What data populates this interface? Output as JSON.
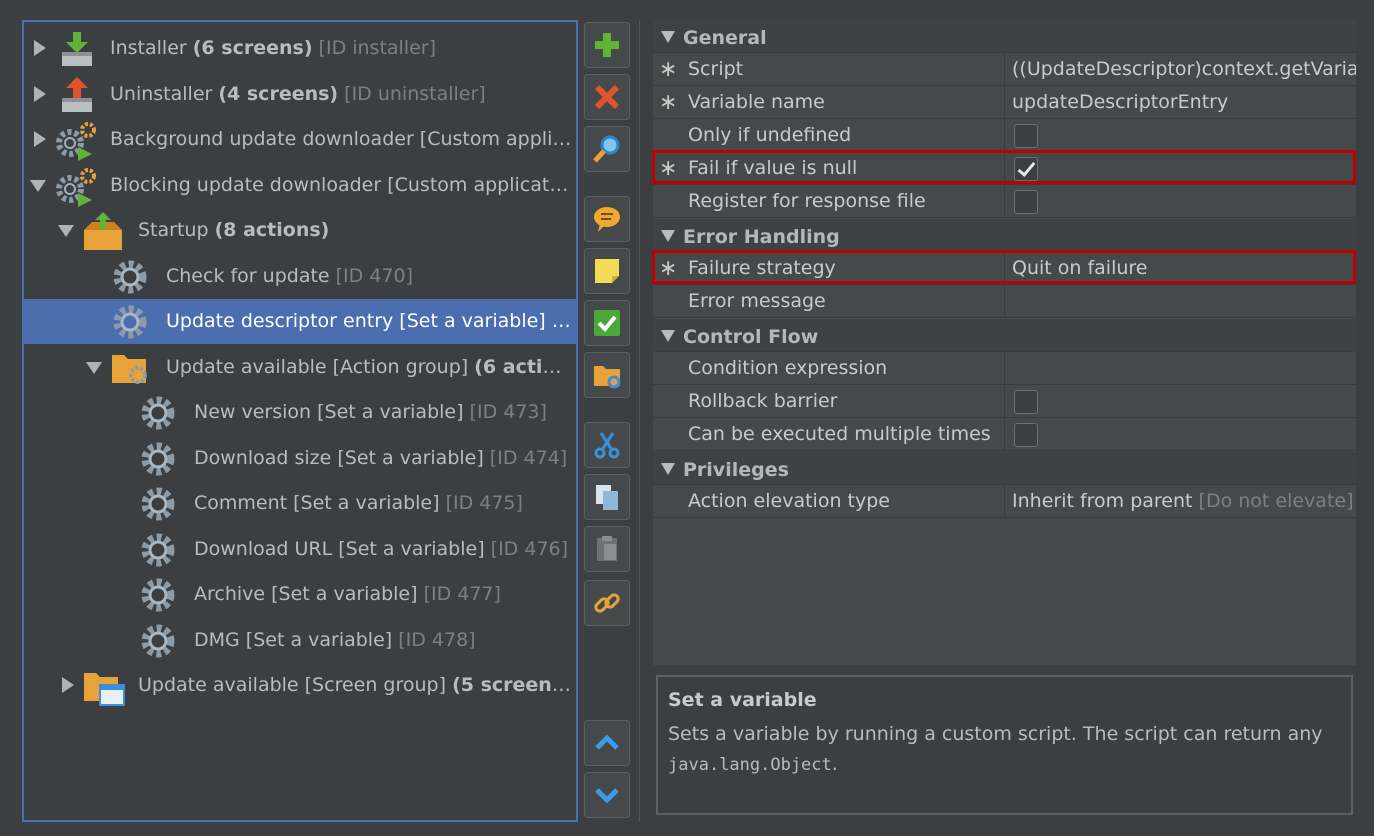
{
  "tree": {
    "items": [
      {
        "label": "Installer ",
        "bold": "(6 screens)",
        "gray": " [ID installer]",
        "icon": "installer-icon",
        "arrow": "collapsed"
      },
      {
        "label": "Uninstaller ",
        "bold": "(4 screens)",
        "gray": " [ID uninstaller]",
        "icon": "uninstaller-icon",
        "arrow": "collapsed"
      },
      {
        "label": "Background update downloader [Custom applic...",
        "bold": "",
        "gray": "",
        "icon": "gears-play-icon",
        "arrow": "collapsed"
      },
      {
        "label": "Blocking update downloader [Custom applicatio...",
        "bold": "",
        "gray": "",
        "icon": "gears-play-icon",
        "arrow": "expanded"
      },
      {
        "label": "Startup ",
        "bold": "(8 actions)",
        "gray": "",
        "icon": "startup-box-icon",
        "arrow": "expanded"
      },
      {
        "label": "Check for update",
        "bold": "",
        "gray": " [ID 470]",
        "icon": "gear-icon",
        "arrow": "none"
      },
      {
        "label": "Update descriptor entry [Set a variable] [I...",
        "bold": "",
        "gray": "",
        "icon": "gear-icon",
        "arrow": "none"
      },
      {
        "label": "Update available [Action group] ",
        "bold": "(6 action...",
        "gray": "",
        "icon": "folder-gear-icon",
        "arrow": "expanded"
      },
      {
        "label": "New version [Set a variable]",
        "bold": "",
        "gray": " [ID 473]",
        "icon": "gear-icon",
        "arrow": "none"
      },
      {
        "label": "Download size [Set a variable]",
        "bold": "",
        "gray": " [ID 474]",
        "icon": "gear-icon",
        "arrow": "none"
      },
      {
        "label": "Comment [Set a variable]",
        "bold": "",
        "gray": " [ID 475]",
        "icon": "gear-icon",
        "arrow": "none"
      },
      {
        "label": "Download URL [Set a variable]",
        "bold": "",
        "gray": " [ID 476]",
        "icon": "gear-icon",
        "arrow": "none"
      },
      {
        "label": "Archive [Set a variable]",
        "bold": "",
        "gray": " [ID 477]",
        "icon": "gear-icon",
        "arrow": "none"
      },
      {
        "label": "DMG [Set a variable]",
        "bold": "",
        "gray": " [ID 478]",
        "icon": "gear-icon",
        "arrow": "none"
      },
      {
        "label": "Update available [Screen group] ",
        "bold": "(5 screens)",
        "gray": " [...",
        "icon": "folder-window-icon",
        "arrow": "collapsed"
      }
    ]
  },
  "toolbar": {
    "buttons": [
      "add-icon",
      "delete-icon",
      "search-icon",
      "comment-icon",
      "note-icon",
      "check-icon",
      "folder-icon",
      "cut-icon",
      "copy-icon",
      "paste-icon",
      "link-icon",
      "move-up-icon",
      "move-down-icon"
    ]
  },
  "properties": {
    "categories": {
      "general": "General",
      "error_handling": "Error Handling",
      "control_flow": "Control Flow",
      "privileges": "Privileges"
    },
    "rows": {
      "script": {
        "name": "Script",
        "value": "((UpdateDescriptor)context.getVariabl",
        "required": true
      },
      "variable_name": {
        "name": "Variable name",
        "value": "updateDescriptorEntry",
        "required": true
      },
      "only_if_undefined": {
        "name": "Only if undefined",
        "checked": false
      },
      "fail_if_null": {
        "name": "Fail if value is null",
        "checked": true,
        "required": true
      },
      "register_response": {
        "name": "Register for response file",
        "checked": false
      },
      "failure_strategy": {
        "name": "Failure strategy",
        "value": "Quit on failure",
        "required": true
      },
      "error_message": {
        "name": "Error message",
        "value": ""
      },
      "condition_expression": {
        "name": "Condition expression",
        "value": ""
      },
      "rollback_barrier": {
        "name": "Rollback barrier",
        "checked": false
      },
      "multiple_times": {
        "name": "Can be executed multiple times",
        "checked": false
      },
      "elevation_type": {
        "name": "Action elevation type",
        "value": "Inherit from parent",
        "value_gray": " [Do not elevate]"
      }
    },
    "required_mark": "∗",
    "highlight_color": "#c00000"
  },
  "description": {
    "title": "Set a variable",
    "text": "Sets a variable by running a custom script. The script can return any",
    "code": "java.lang.Object",
    "end": "."
  },
  "colors": {
    "selection": "#4b6eaf",
    "background": "#3c3f41"
  }
}
